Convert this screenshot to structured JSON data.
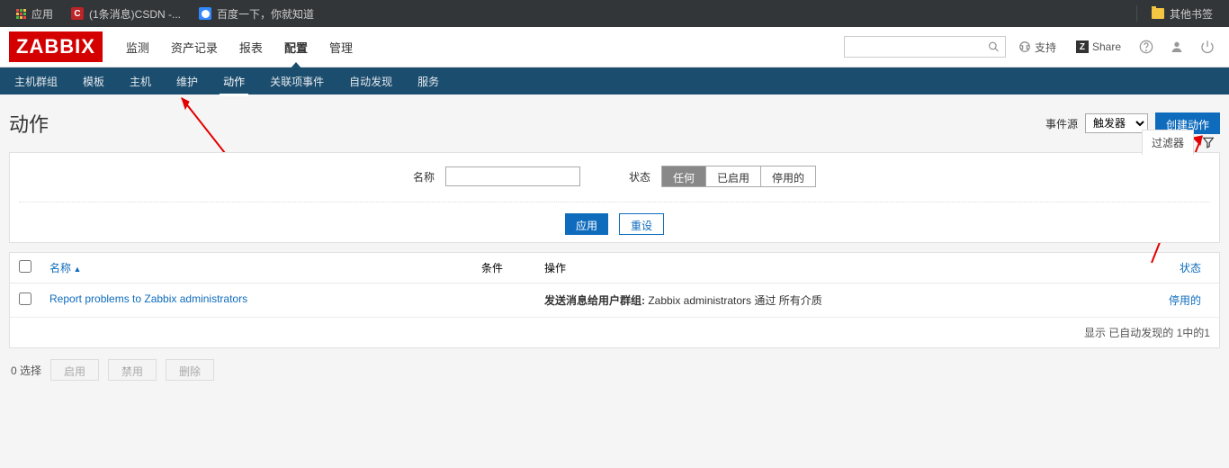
{
  "browser": {
    "apps": "应用",
    "csdn": "(1条消息)CSDN -...",
    "baidu": "百度一下，你就知道",
    "other": "其他书签"
  },
  "header": {
    "logo": "ZABBIX",
    "support": "支持",
    "share": "Share",
    "nav": {
      "monitor": "监测",
      "inventory": "资产记录",
      "report": "报表",
      "config": "配置",
      "admin": "管理"
    },
    "subnav": {
      "hostgroup": "主机群组",
      "template": "模板",
      "host": "主机",
      "maintenance": "维护",
      "action": "动作",
      "correlation": "关联项事件",
      "discovery": "自动发现",
      "service": "服务"
    }
  },
  "page": {
    "title": "动作",
    "eventsource_label": "事件源",
    "eventsource_value": "触发器",
    "create_btn": "创建动作",
    "filter_tab": "过滤器"
  },
  "filter": {
    "name_label": "名称",
    "status_label": "状态",
    "seg_any": "任何",
    "seg_enabled": "已启用",
    "seg_disabled": "停用的",
    "apply": "应用",
    "reset": "重设"
  },
  "table": {
    "col_name": "名称",
    "col_cond": "条件",
    "col_op": "操作",
    "col_status": "状态",
    "row1": {
      "name": "Report problems to Zabbix administrators",
      "op_bold": "发送消息给用户群组:",
      "op_rest": " Zabbix administrators 通过 所有介质",
      "status": "停用的"
    },
    "footer": "显示 已自动发现的 1中的1"
  },
  "bottom": {
    "selected": "0 选择",
    "enable": "启用",
    "disable": "禁用",
    "delete": "删除"
  }
}
